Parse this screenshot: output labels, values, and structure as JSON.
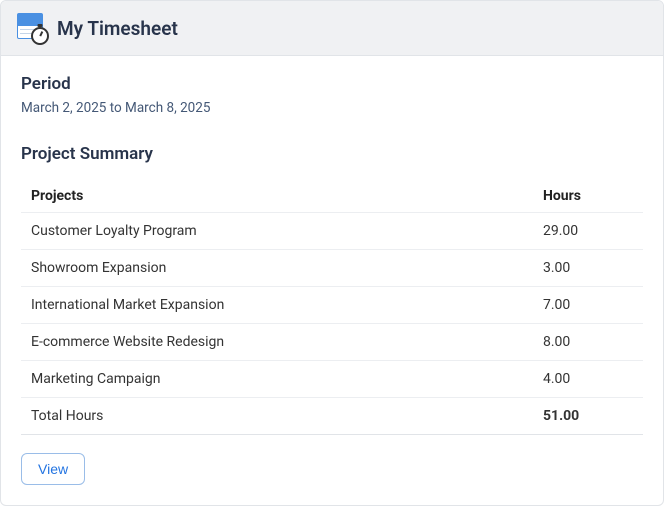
{
  "header": {
    "title": "My Timesheet"
  },
  "period": {
    "label": "Period",
    "text": "March 2, 2025 to March 8, 2025"
  },
  "summary": {
    "heading": "Project Summary",
    "columns": {
      "projects": "Projects",
      "hours": "Hours"
    },
    "rows": [
      {
        "name": "Customer Loyalty Program",
        "hours": "29.00"
      },
      {
        "name": "Showroom Expansion",
        "hours": "3.00"
      },
      {
        "name": "International Market Expansion",
        "hours": "7.00"
      },
      {
        "name": "E-commerce Website Redesign",
        "hours": "8.00"
      },
      {
        "name": "Marketing Campaign",
        "hours": "4.00"
      }
    ],
    "total": {
      "label": "Total Hours",
      "hours": "51.00"
    }
  },
  "actions": {
    "view": "View"
  }
}
